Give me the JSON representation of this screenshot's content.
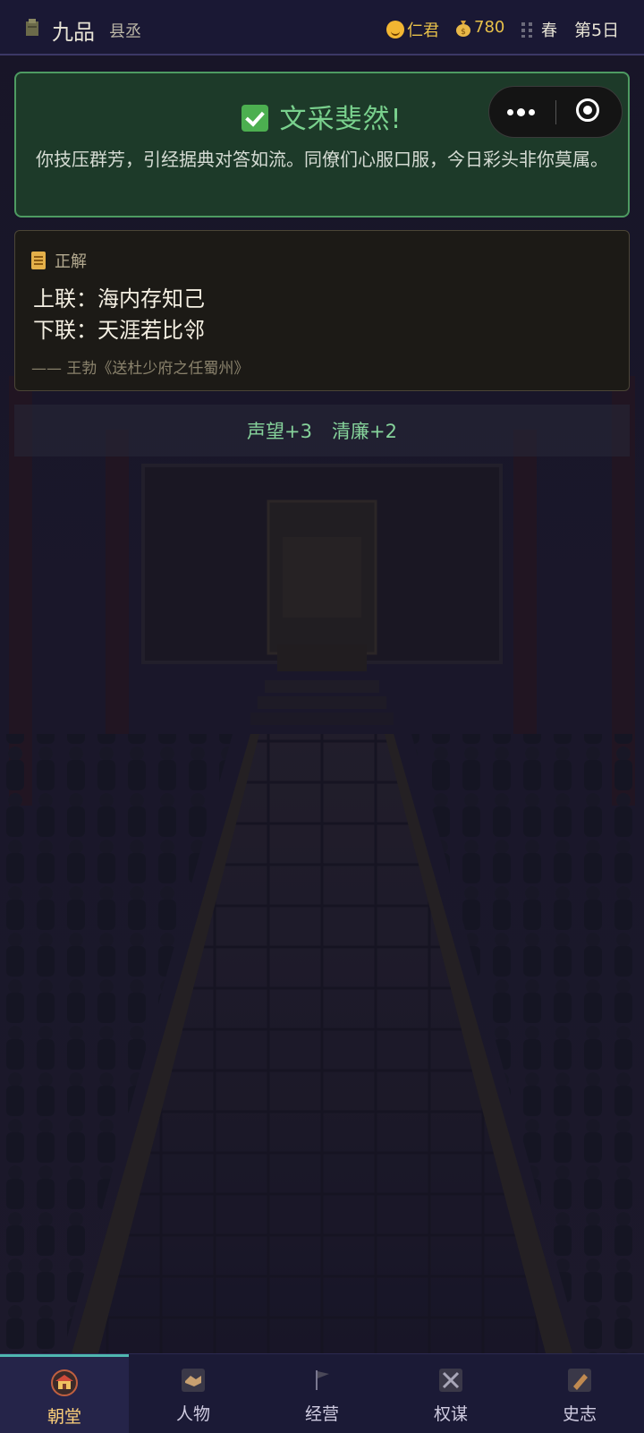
{
  "status_bar": {
    "rank": "九品",
    "post": "县丞",
    "morality": "仁君",
    "money": "780",
    "season": "春",
    "day": "第5日"
  },
  "result": {
    "title": "文采斐然!",
    "description": "你技压群芳，引经据典对答如流。同僚们心服口服，今日彩头非你莫属。"
  },
  "answer": {
    "header": "正解",
    "upper_line": "上联：海内存知己",
    "lower_line": "下联：天涯若比邻",
    "source": "—— 王勃《送杜少府之任蜀州》"
  },
  "rewards": [
    "声望+3",
    "清廉+2"
  ],
  "tabs": [
    {
      "label": "朝堂",
      "icon": "palace-icon",
      "active": true
    },
    {
      "label": "人物",
      "icon": "handshake-icon",
      "active": false
    },
    {
      "label": "经营",
      "icon": "flag-icon",
      "active": false
    },
    {
      "label": "权谋",
      "icon": "crossed-swords-icon",
      "active": false
    },
    {
      "label": "史志",
      "icon": "scroll-icon",
      "active": false
    }
  ],
  "colors": {
    "success_green": "#79d08d",
    "gold": "#e8c14a",
    "active_tab_accent": "#4fb7b0"
  }
}
